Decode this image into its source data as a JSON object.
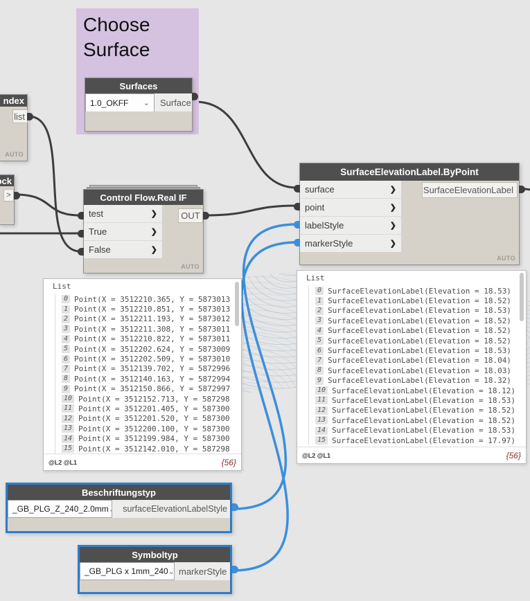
{
  "colors": {
    "canvas": "#e6e6e6",
    "group_purple": "#d5c2e0",
    "node_header_gray": "#4f4f4f",
    "node_body_beige": "#d6d2ca",
    "wire_dark": "#3d3d3d",
    "accent_blue": "#3b8ede",
    "selection_border_blue": "#2e7dc8",
    "count_red": "#8d2f2f"
  },
  "icons": {
    "port_chevron": "❯",
    "dropdown_chevron": "⌄"
  },
  "group": {
    "title": "Choose Surface"
  },
  "nodes": {
    "surfaces": {
      "title": "Surfaces",
      "dropdown_value": "1.0_OKFF",
      "output": "Surface"
    },
    "partial_index": {
      "title": "ndex",
      "output": "list",
      "footer": "AUTO"
    },
    "partial_block": {
      "title": "ock",
      "output": ">"
    },
    "real_if": {
      "title": "Control Flow.Real IF",
      "inputs": [
        "test",
        "True",
        "False"
      ],
      "output": "OUT",
      "footer": "AUTO"
    },
    "selabel": {
      "title": "SurfaceElevationLabel.ByPoint",
      "inputs": [
        "surface",
        "point",
        "labelStyle",
        "markerStyle"
      ],
      "output": "SurfaceElevationLabel",
      "footer": "AUTO"
    },
    "label_style": {
      "title": "Beschriftungstyp",
      "dropdown_value": "_GB_PLG_Z_240_2.0mm",
      "output": "surfaceElevationLabelStyle"
    },
    "marker_style": {
      "title": "Symboltyp",
      "dropdown_value": "_GB_PLG x 1mm_240",
      "output": "markerStyle"
    }
  },
  "left_list": {
    "root": "List",
    "items": [
      {
        "i": "0",
        "t": "Point(X = 3512210.365, Y = 5873013"
      },
      {
        "i": "1",
        "t": "Point(X = 3512210.851, Y = 5873013"
      },
      {
        "i": "2",
        "t": "Point(X = 3512211.193, Y = 5873012"
      },
      {
        "i": "3",
        "t": "Point(X = 3512211.308, Y = 5873011"
      },
      {
        "i": "4",
        "t": "Point(X = 3512210.822, Y = 5873011"
      },
      {
        "i": "5",
        "t": "Point(X = 3512202.624, Y = 5873009"
      },
      {
        "i": "6",
        "t": "Point(X = 3512202.509, Y = 5873010"
      },
      {
        "i": "7",
        "t": "Point(X = 3512139.702, Y = 5872996"
      },
      {
        "i": "8",
        "t": "Point(X = 3512140.163, Y = 5872994"
      },
      {
        "i": "9",
        "t": "Point(X = 3512150.866, Y = 5872997"
      },
      {
        "i": "10",
        "t": "Point(X = 3512152.713, Y = 587298"
      },
      {
        "i": "11",
        "t": "Point(X = 3512201.405, Y = 587300"
      },
      {
        "i": "12",
        "t": "Point(X = 3512201.520, Y = 587300"
      },
      {
        "i": "13",
        "t": "Point(X = 3512200.100, Y = 587300"
      },
      {
        "i": "14",
        "t": "Point(X = 3512199.984, Y = 587300"
      },
      {
        "i": "15",
        "t": "Point(X = 3512142.010, Y = 587298"
      }
    ],
    "lacing": "@L2 @L1",
    "count": "{56}"
  },
  "right_list": {
    "root": "List",
    "items": [
      {
        "i": "0",
        "t": "SurfaceElevationLabel(Elevation = 18.53)"
      },
      {
        "i": "1",
        "t": "SurfaceElevationLabel(Elevation = 18.52)"
      },
      {
        "i": "2",
        "t": "SurfaceElevationLabel(Elevation = 18.53)"
      },
      {
        "i": "3",
        "t": "SurfaceElevationLabel(Elevation = 18.52)"
      },
      {
        "i": "4",
        "t": "SurfaceElevationLabel(Elevation = 18.52)"
      },
      {
        "i": "5",
        "t": "SurfaceElevationLabel(Elevation = 18.52)"
      },
      {
        "i": "6",
        "t": "SurfaceElevationLabel(Elevation = 18.53)"
      },
      {
        "i": "7",
        "t": "SurfaceElevationLabel(Elevation = 18.04)"
      },
      {
        "i": "8",
        "t": "SurfaceElevationLabel(Elevation = 18.03)"
      },
      {
        "i": "9",
        "t": "SurfaceElevationLabel(Elevation = 18.32)"
      },
      {
        "i": "10",
        "t": "SurfaceElevationLabel(Elevation = 18.12)"
      },
      {
        "i": "11",
        "t": "SurfaceElevationLabel(Elevation = 18.53)"
      },
      {
        "i": "12",
        "t": "SurfaceElevationLabel(Elevation = 18.52)"
      },
      {
        "i": "13",
        "t": "SurfaceElevationLabel(Elevation = 18.52)"
      },
      {
        "i": "14",
        "t": "SurfaceElevationLabel(Elevation = 18.53)"
      },
      {
        "i": "15",
        "t": "SurfaceElevationLabel(Elevation = 17.97)"
      }
    ],
    "lacing": "@L2 @L1",
    "count": "{56}"
  }
}
